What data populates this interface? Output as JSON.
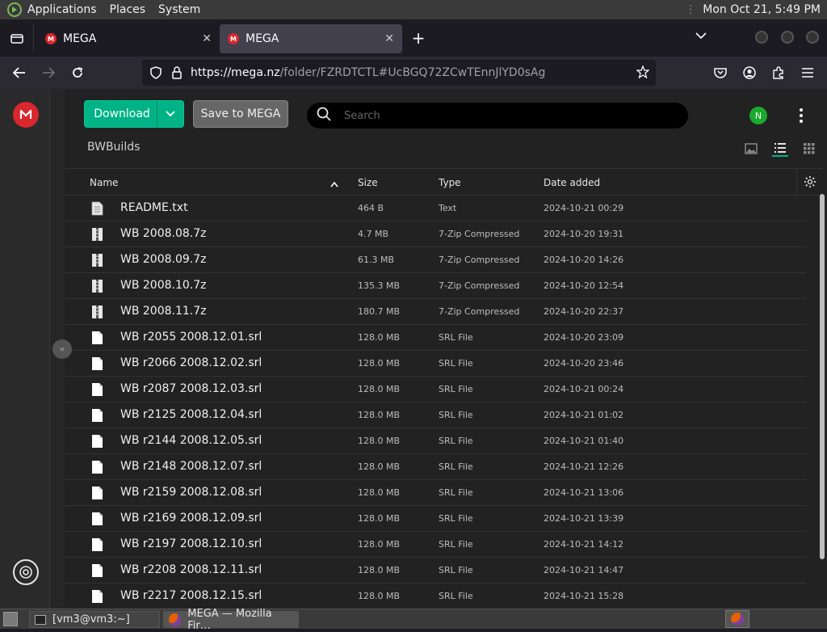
{
  "system_bar": {
    "menus": [
      "Applications",
      "Places",
      "System"
    ],
    "datetime": "Mon Oct 21,  5:49 PM"
  },
  "browser": {
    "tabs": [
      {
        "label": "MEGA",
        "favicon": "M"
      },
      {
        "label": "MEGA",
        "favicon": "M"
      }
    ],
    "url_host": "https://mega.nz",
    "url_path": "/folder/FZRDTCTL#UcBGQ72ZCwTEnnJlYD0sAg"
  },
  "toolbar": {
    "download_label": "Download",
    "save_label": "Save to MEGA",
    "search_placeholder": "Search",
    "avatar_initial": "N"
  },
  "breadcrumb": "BWBuilds",
  "table": {
    "columns": [
      "Name",
      "Size",
      "Type",
      "Date added"
    ],
    "rows": [
      {
        "name": "README.txt",
        "size": "464 B",
        "type": "Text",
        "date": "2024-10-21 00:29",
        "icon": "text-file-icon"
      },
      {
        "name": "WB 2008.08.7z",
        "size": "4.7 MB",
        "type": "7-Zip Compressed",
        "date": "2024-10-20 19:31",
        "icon": "archive-file-icon"
      },
      {
        "name": "WB 2008.09.7z",
        "size": "61.3 MB",
        "type": "7-Zip Compressed",
        "date": "2024-10-20 14:26",
        "icon": "archive-file-icon"
      },
      {
        "name": "WB 2008.10.7z",
        "size": "135.3 MB",
        "type": "7-Zip Compressed",
        "date": "2024-10-20 12:54",
        "icon": "archive-file-icon"
      },
      {
        "name": "WB 2008.11.7z",
        "size": "180.7 MB",
        "type": "7-Zip Compressed",
        "date": "2024-10-20 22:37",
        "icon": "archive-file-icon"
      },
      {
        "name": "WB r2055 2008.12.01.srl",
        "size": "128.0 MB",
        "type": "SRL File",
        "date": "2024-10-20 23:09",
        "icon": "generic-file-icon"
      },
      {
        "name": "WB r2066 2008.12.02.srl",
        "size": "128.0 MB",
        "type": "SRL File",
        "date": "2024-10-20 23:46",
        "icon": "generic-file-icon"
      },
      {
        "name": "WB r2087 2008.12.03.srl",
        "size": "128.0 MB",
        "type": "SRL File",
        "date": "2024-10-21 00:24",
        "icon": "generic-file-icon"
      },
      {
        "name": "WB r2125 2008.12.04.srl",
        "size": "128.0 MB",
        "type": "SRL File",
        "date": "2024-10-21 01:02",
        "icon": "generic-file-icon"
      },
      {
        "name": "WB r2144 2008.12.05.srl",
        "size": "128.0 MB",
        "type": "SRL File",
        "date": "2024-10-21 01:40",
        "icon": "generic-file-icon"
      },
      {
        "name": "WB r2148 2008.12.07.srl",
        "size": "128.0 MB",
        "type": "SRL File",
        "date": "2024-10-21 12:26",
        "icon": "generic-file-icon"
      },
      {
        "name": "WB r2159 2008.12.08.srl",
        "size": "128.0 MB",
        "type": "SRL File",
        "date": "2024-10-21 13:06",
        "icon": "generic-file-icon"
      },
      {
        "name": "WB r2169 2008.12.09.srl",
        "size": "128.0 MB",
        "type": "SRL File",
        "date": "2024-10-21 13:39",
        "icon": "generic-file-icon"
      },
      {
        "name": "WB r2197 2008.12.10.srl",
        "size": "128.0 MB",
        "type": "SRL File",
        "date": "2024-10-21 14:12",
        "icon": "generic-file-icon"
      },
      {
        "name": "WB r2208 2008.12.11.srl",
        "size": "128.0 MB",
        "type": "SRL File",
        "date": "2024-10-21 14:47",
        "icon": "generic-file-icon"
      },
      {
        "name": "WB r2217 2008.12.15.srl",
        "size": "128.0 MB",
        "type": "SRL File",
        "date": "2024-10-21 15:28",
        "icon": "generic-file-icon"
      }
    ]
  },
  "taskbar": {
    "items": [
      "[vm3@vm3:~]",
      "MEGA — Mozilla Fir…"
    ]
  },
  "colors": {
    "accent": "#00b386",
    "brand": "#d9272e",
    "avatar": "#1aaa2c"
  }
}
